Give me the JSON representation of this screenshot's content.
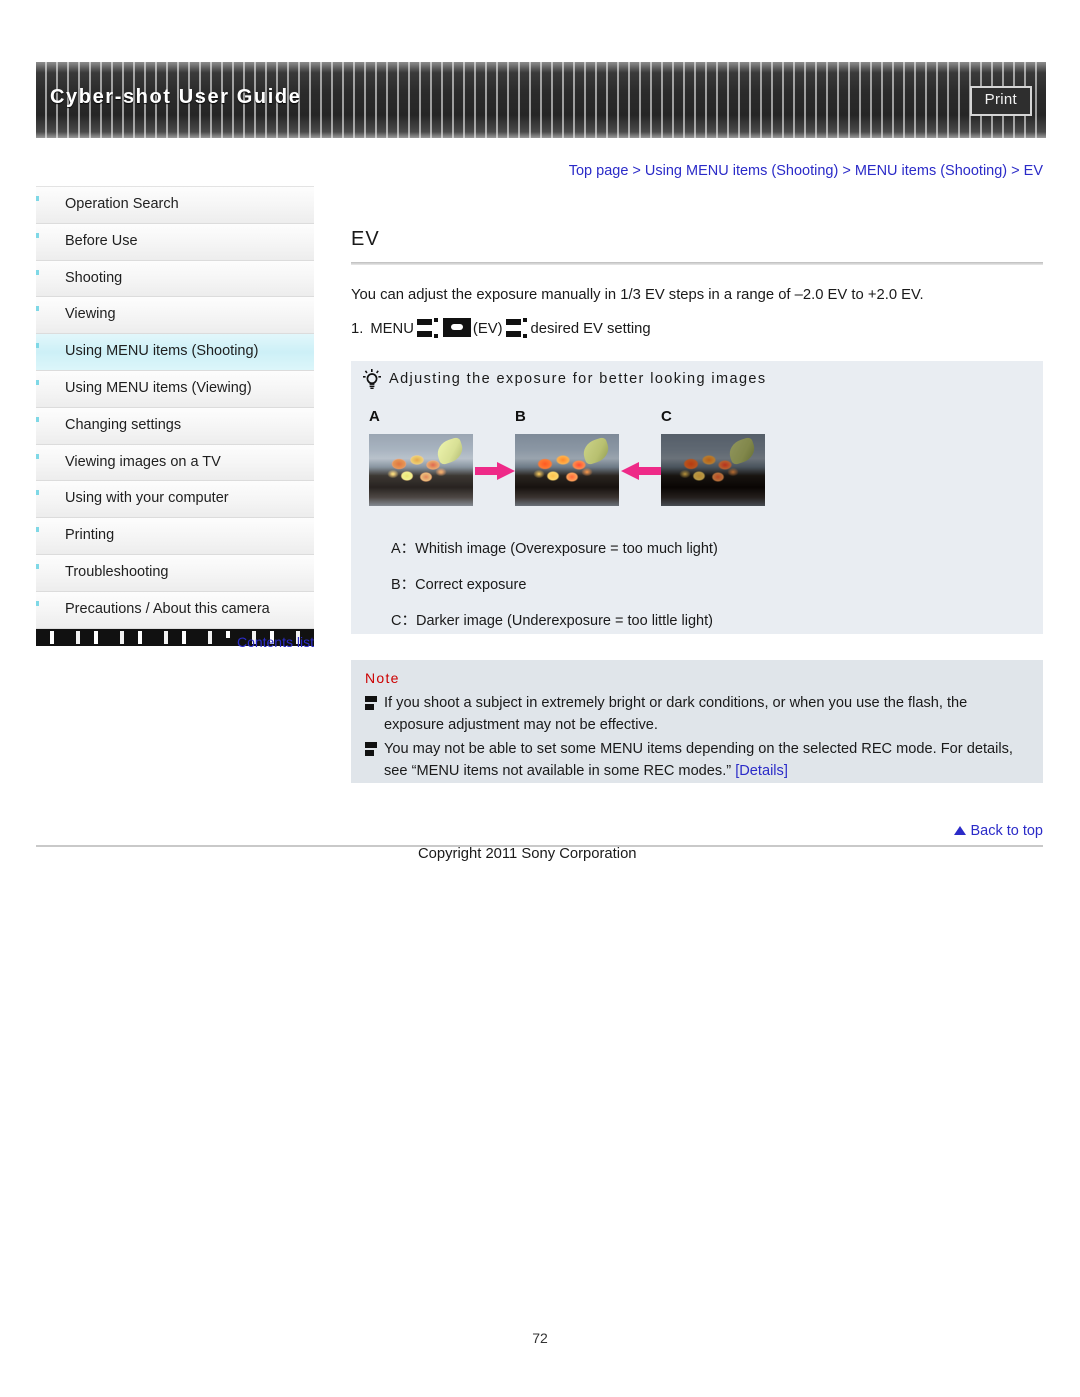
{
  "header": {
    "title": "Cyber-shot User Guide",
    "print_label": "Print",
    "print_icon": "print-icon"
  },
  "sidebar": {
    "items": [
      {
        "label": "Operation Search",
        "active": false
      },
      {
        "label": "Before Use",
        "active": false
      },
      {
        "label": "Shooting",
        "active": false
      },
      {
        "label": "Viewing",
        "active": false
      },
      {
        "label": "Using MENU items (Shooting)",
        "active": true
      },
      {
        "label": "Using MENU items (Viewing)",
        "active": false
      },
      {
        "label": "Changing settings",
        "active": false
      },
      {
        "label": "Viewing images on a TV",
        "active": false
      },
      {
        "label": "Using with your computer",
        "active": false
      },
      {
        "label": "Printing",
        "active": false
      },
      {
        "label": "Troubleshooting",
        "active": false
      },
      {
        "label": "Precautions / About this camera",
        "active": false
      }
    ],
    "contents_link": "Contents list"
  },
  "main": {
    "breadcrumb": "Top page > Using MENU items (Shooting) > MENU items (Shooting) > EV",
    "title": "EV",
    "intro": "You can adjust the exposure manually in 1/3 EV steps in a range of –2.0 EV to +2.0 EV.",
    "step": {
      "number": "1.",
      "word_menu": "MENU",
      "ev_label": "(EV)",
      "tail": "desired EV setting"
    },
    "tip": {
      "heading": "Adjusting the exposure for better looking images",
      "icon": "lightbulb-icon",
      "figure_labels": [
        "A",
        "B",
        "C"
      ],
      "captions": [
        "A：Whitish image (Overexposure = too much light)",
        "B：Correct exposure",
        "C：Darker image (Underexposure = too little light)"
      ],
      "arrow_color": "#ee2a88"
    },
    "note": {
      "title": "Note",
      "title_color": "#cc0000",
      "items": [
        "If you shoot a subject in extremely bright or dark conditions, or when you use the flash, the exposure adjustment may not be effective.",
        "You may not be able to set some MENU items depending on the selected REC mode. For details, see “MENU items not available in some REC modes.” "
      ],
      "details_link": "[Details]"
    }
  },
  "footer": {
    "back_to_top": "Back to top",
    "copyright": "Copyright 2011 Sony Corporation",
    "page_number": "72"
  },
  "colors": {
    "link": "#2b2bc8",
    "tip_bg": "#e9edf2",
    "note_bg": "#e0e5ea",
    "active_sidebar": "#cdf0f7"
  }
}
